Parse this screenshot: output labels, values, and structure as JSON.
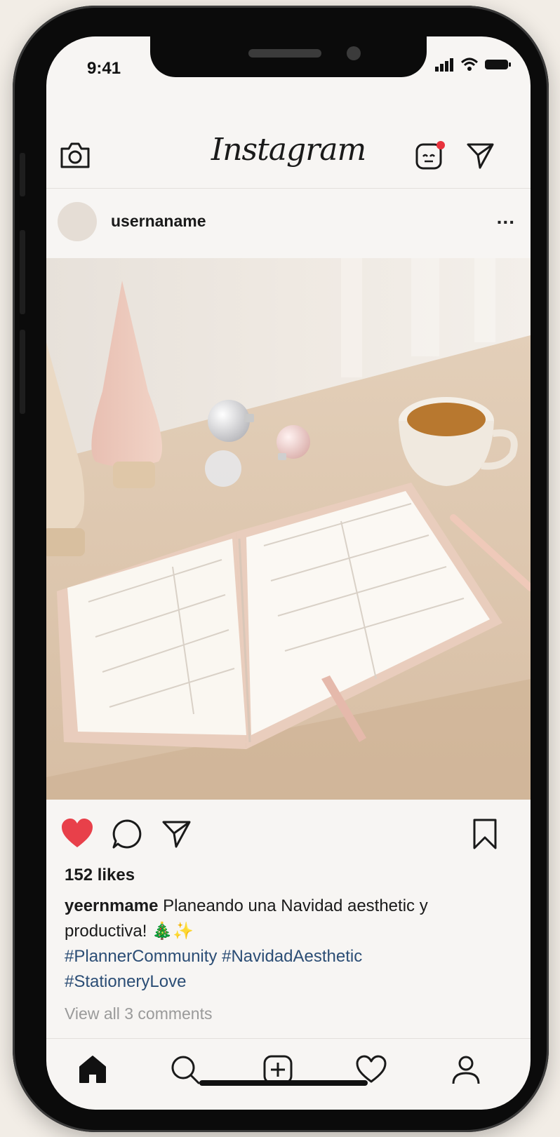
{
  "status": {
    "time": "9:41"
  },
  "header": {
    "logo_text": "Instagram",
    "icons": [
      "camera-icon",
      "reels-icon",
      "send-icon"
    ],
    "notification_dot_color": "#e8323c"
  },
  "post": {
    "username": "usernaname",
    "more_label": "...",
    "liked": true,
    "like_color": "#e8404a",
    "likes_text": "152 likes",
    "caption_user": "yeernmame",
    "caption_text": "Planeando una Navidad aesthetic y productiva! 🎄✨",
    "hashtags_line1": "#PlannerCommunity #NavidadAesthetic",
    "hashtags_line2": "#StationeryLove",
    "view_comments": "View all 3 comments"
  },
  "bottom_nav": {
    "items": [
      "home-icon",
      "search-icon",
      "new-post-icon",
      "activity-heart-icon",
      "profile-icon"
    ],
    "active": "home-icon"
  }
}
